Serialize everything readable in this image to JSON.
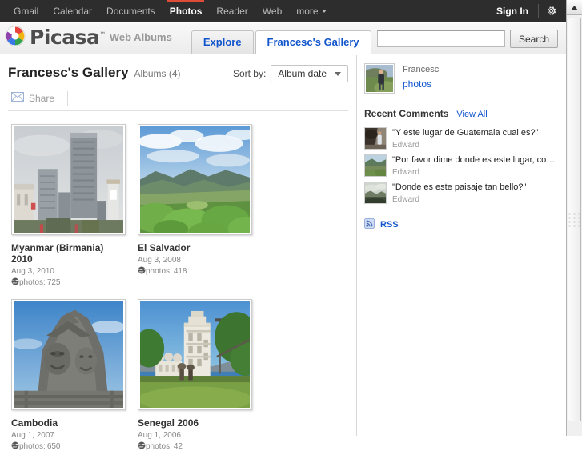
{
  "gbar": {
    "links": [
      {
        "label": "Gmail",
        "active": false
      },
      {
        "label": "Calendar",
        "active": false
      },
      {
        "label": "Documents",
        "active": false
      },
      {
        "label": "Photos",
        "active": true
      },
      {
        "label": "Reader",
        "active": false
      },
      {
        "label": "Web",
        "active": false
      }
    ],
    "more_label": "more",
    "signin_label": "Sign In",
    "gear_icon": "gear-icon",
    "active_underline_color": "#dd4b39"
  },
  "header": {
    "logo_text": "Picasa",
    "logo_tm": "™",
    "logo_subtitle": "Web Albums",
    "logo_icon": "picasa-pinwheel-icon",
    "tabs": [
      {
        "label": "Explore",
        "active": false
      },
      {
        "label": "Francesc's Gallery",
        "active": true
      }
    ],
    "search": {
      "value": "",
      "placeholder": "",
      "button_label": "Search",
      "icon": "search-icon"
    },
    "link_color": "#1155cc"
  },
  "main": {
    "gallery_title": "Francesc's Gallery",
    "albums_count_label": "Albums (4)",
    "sort": {
      "label": "Sort by:",
      "value": "Album date",
      "caret_icon": "chevron-down-icon"
    },
    "toolbar": {
      "share_label": "Share",
      "share_icon": "envelope-icon"
    },
    "photos_icon": "photos-globe-icon",
    "albums": [
      {
        "title": "Myanmar (Birmania) 2010",
        "date": "Aug 3, 2010",
        "photos_label": "photos:",
        "photos_count": "725",
        "thumb_name": "album-thumb-myanmar"
      },
      {
        "title": "El Salvador",
        "date": "Aug 3, 2008",
        "photos_label": "photos:",
        "photos_count": "418",
        "thumb_name": "album-thumb-el-salvador"
      },
      {
        "title": "Cambodia",
        "date": "Aug 1, 2007",
        "photos_label": "photos:",
        "photos_count": "650",
        "thumb_name": "album-thumb-cambodia"
      },
      {
        "title": "Senegal 2006",
        "date": "Aug 1, 2006",
        "photos_label": "photos:",
        "photos_count": "42",
        "thumb_name": "album-thumb-senegal"
      }
    ]
  },
  "sidebar": {
    "profile": {
      "name": "Francesc",
      "photos_link": "photos",
      "avatar_name": "profile-avatar"
    },
    "recent_comments": {
      "title": "Recent Comments",
      "view_all_label": "View All",
      "items": [
        {
          "text": "\"Y este lugar de Guatemala cual es?\"",
          "author": "Edward"
        },
        {
          "text": "\"Por favor dime donde es este lugar, como se l...",
          "author": "Edward"
        },
        {
          "text": "\"Donde es este paisaje tan bello?\"",
          "author": "Edward"
        }
      ]
    },
    "rss": {
      "label": "RSS",
      "icon": "rss-icon"
    }
  },
  "scrollbar": {
    "up_arrow_icon": "scroll-up-arrow-icon"
  }
}
